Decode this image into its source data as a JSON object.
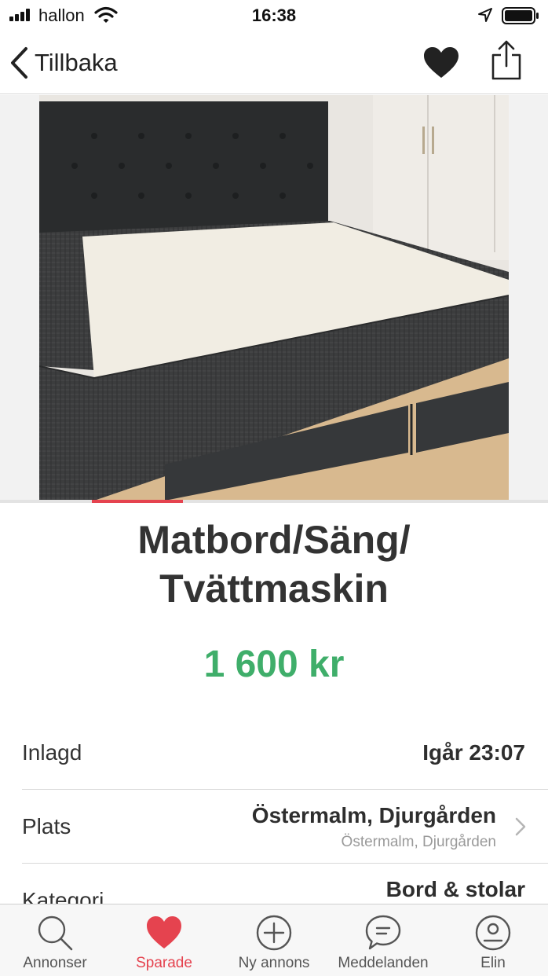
{
  "status_bar": {
    "carrier": "hallon",
    "time": "16:38",
    "icons": [
      "signal-icon",
      "wifi-icon",
      "location-arrow-icon",
      "battery-icon"
    ]
  },
  "nav": {
    "back_label": "Tillbaka",
    "icons": [
      "chevron-left-icon",
      "heart-icon",
      "share-icon"
    ]
  },
  "listing": {
    "title": "Matbord/Säng/ Tvättmaskin",
    "price": "1 600 kr",
    "photo": "bed-photo",
    "image_count": 6,
    "current_image": 1
  },
  "details": {
    "posted": {
      "label": "Inlagd",
      "value": "Igår 23:07"
    },
    "location": {
      "label": "Plats",
      "value": "Östermalm, Djurgården",
      "sub": "Östermalm, Djurgården"
    },
    "category": {
      "label": "Kategori",
      "value": "Bord & stolar"
    }
  },
  "tab_bar": {
    "active_tab": "Sparade",
    "tabs": [
      {
        "label": "Annonser",
        "icon": "search-icon"
      },
      {
        "label": "Sparade",
        "icon": "heart-icon"
      },
      {
        "label": "Ny annons",
        "icon": "plus-circle-icon"
      },
      {
        "label": "Meddelanden",
        "icon": "chat-bubble-icon"
      },
      {
        "label": "Elin",
        "icon": "profile-icon"
      }
    ]
  },
  "colors": {
    "accent_red": "#e5434f",
    "price_green": "#3fae6a",
    "text_dark": "#2e2e2e",
    "text_muted": "#9a9a9a",
    "divider": "#d9d9d9"
  }
}
